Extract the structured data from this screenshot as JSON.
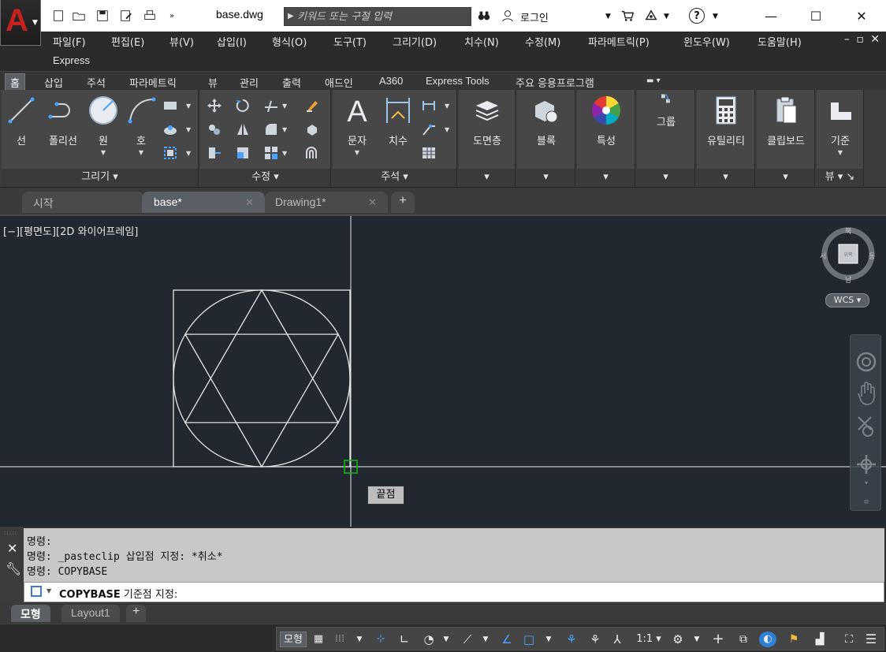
{
  "title_bar": {
    "doc_title": "base.dwg",
    "search_placeholder": "키워드 또는 구절 입력",
    "login_label": "로그인",
    "help_glyph": "?",
    "minimize_glyph": "—",
    "maximize_glyph": "☐",
    "close_glyph": "✕"
  },
  "menu": {
    "items": [
      "파일(F)",
      "편집(E)",
      "뷰(V)",
      "삽입(I)",
      "형식(O)",
      "도구(T)",
      "그리기(D)",
      "치수(N)",
      "수정(M)",
      "파라메트릭(P)",
      "윈도우(W)",
      "도움말(H)"
    ],
    "express": "Express",
    "mdi_controls": "– ▫ ✕"
  },
  "ribbon_tabs": [
    "홈",
    "삽입",
    "주석",
    "파라메트릭",
    "뷰",
    "관리",
    "출력",
    "애드인",
    "A360",
    "Express Tools",
    "주요 응용프로그램"
  ],
  "ribbon": {
    "draw": {
      "title": "그리기",
      "line": "선",
      "polyline": "폴리선",
      "circle": "원",
      "arc": "호"
    },
    "modify": {
      "title": "수정"
    },
    "annotation": {
      "title": "주석",
      "text": "문자",
      "dimension": "치수"
    },
    "layers": {
      "title": "도면층"
    },
    "block": {
      "title": "블록"
    },
    "properties": {
      "title": "특성"
    },
    "groups": {
      "title": "그룹"
    },
    "utilities": {
      "title": "유틸리티"
    },
    "clipboard": {
      "title": "클립보드"
    },
    "view": {
      "title": "기준",
      "footer": "뷰"
    }
  },
  "doc_tabs": [
    {
      "label": "시작"
    },
    {
      "label": "base*"
    },
    {
      "label": "Drawing1*"
    }
  ],
  "viewport": {
    "label": "[−][평면도][2D 와이어프레임]",
    "snap_tooltip": "끝점",
    "compass": {
      "north": "북",
      "south": "남",
      "east": "동",
      "west": "서"
    },
    "wcs": "WCS ▾"
  },
  "command_line": {
    "history": [
      "명령:",
      "명령: _pasteclip 삽입점 지정: *취소*",
      "명령: COPYBASE"
    ],
    "prompt_command": "COPYBASE",
    "prompt_text": " 기준점 지정:"
  },
  "layout_tabs": [
    "모형",
    "Layout1"
  ],
  "status_bar": {
    "model": "모형",
    "scale": "1:1"
  },
  "colors": {
    "viewport_bg": "#212830",
    "snap_marker": "#12b312",
    "accent_blue": "#2e7fd6"
  }
}
